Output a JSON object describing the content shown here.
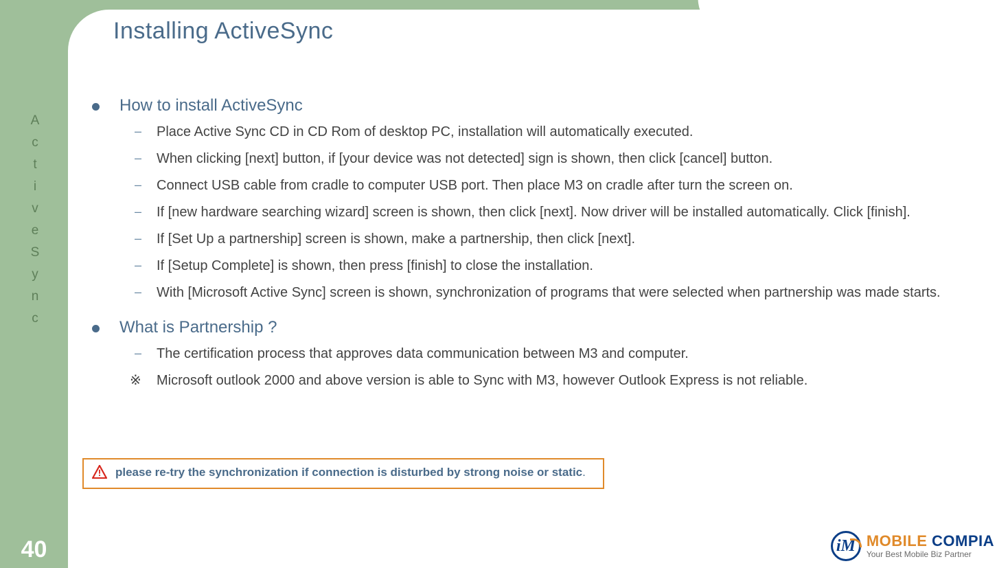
{
  "page_number": "40",
  "sidebar_label": [
    "A",
    "c",
    "t",
    "i",
    "v",
    "e",
    "S",
    "y",
    "n",
    "c"
  ],
  "title": "Installing ActiveSync",
  "sections": [
    {
      "heading": "How to install ActiveSync",
      "items": [
        "Place Active Sync CD in CD Rom of desktop PC, installation will automatically executed.",
        "When clicking [next] button, if [your device was not detected] sign is shown, then click [cancel] button.",
        "Connect USB cable from cradle to computer USB port. Then place M3 on cradle after turn the screen on.",
        "If [new hardware searching wizard] screen is shown, then click [next]. Now driver will be installed automatically. Click [finish].",
        "If [Set Up a partnership] screen is shown, make a partnership, then click [next].",
        "If [Setup Complete] is shown, then press [finish] to close the installation.",
        "With [Microsoft Active Sync] screen is shown, synchronization of programs that were selected when partnership was made starts."
      ]
    },
    {
      "heading": "What is Partnership ?",
      "items": [
        "The certification process that approves data communication between M3 and computer."
      ],
      "note": "Microsoft outlook 2000 and above version is able to Sync with M3, however Outlook Express is not reliable."
    }
  ],
  "warning": "please re-try the synchronization if connection is disturbed by strong noise or static",
  "warning_period": ".",
  "logo": {
    "badge": "iM",
    "line1a": "MOBILE ",
    "line1b": "COMPIA",
    "line2": "Your Best Mobile Biz Partner"
  }
}
